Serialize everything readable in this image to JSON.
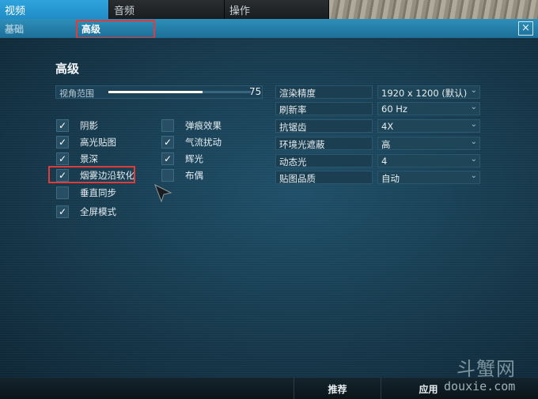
{
  "tabs": [
    {
      "label": "视频",
      "active": true
    },
    {
      "label": "音频",
      "active": false
    },
    {
      "label": "操作",
      "active": false
    }
  ],
  "subtabs": [
    {
      "label": "基础",
      "active": false
    },
    {
      "label": "高级",
      "active": true
    }
  ],
  "close_label": "×",
  "panel": {
    "title": "高级",
    "view_distance": {
      "label": "视角范围",
      "value": "75",
      "fraction": 0.66
    }
  },
  "checkboxes": {
    "shadows": {
      "label": "阴影",
      "checked": true
    },
    "bloom": {
      "label": "高光贴图",
      "checked": true
    },
    "depth_of_field": {
      "label": "景深",
      "checked": true
    },
    "fog_edge_soften": {
      "label": "烟雾边沿软化",
      "checked": true
    },
    "vsync": {
      "label": "垂直同步",
      "checked": false
    },
    "fullscreen": {
      "label": "全屏模式",
      "checked": true
    },
    "shell_effects": {
      "label": "弹痕效果",
      "checked": false
    },
    "air_turbulence": {
      "label": "气流扰动",
      "checked": true
    },
    "glow": {
      "label": "辉光",
      "checked": true
    },
    "cloth": {
      "label": "布偶",
      "checked": false
    }
  },
  "settings": [
    {
      "label": "渲染精度",
      "value": "1920 x 1200 (默认)"
    },
    {
      "label": "刷新率",
      "value": "60 Hz"
    },
    {
      "label": "抗锯齿",
      "value": "4X"
    },
    {
      "label": "环境光遮蔽",
      "value": "高"
    },
    {
      "label": "动态光",
      "value": "4"
    },
    {
      "label": "贴图品质",
      "value": "自动"
    }
  ],
  "bottom": {
    "recommend": "推荐",
    "apply": "应用"
  },
  "watermark": {
    "brand": "斗蟹网",
    "url": "douxie.com"
  },
  "colors": {
    "accent": "#2fa3dd",
    "highlight_box": "#e03c3c"
  }
}
